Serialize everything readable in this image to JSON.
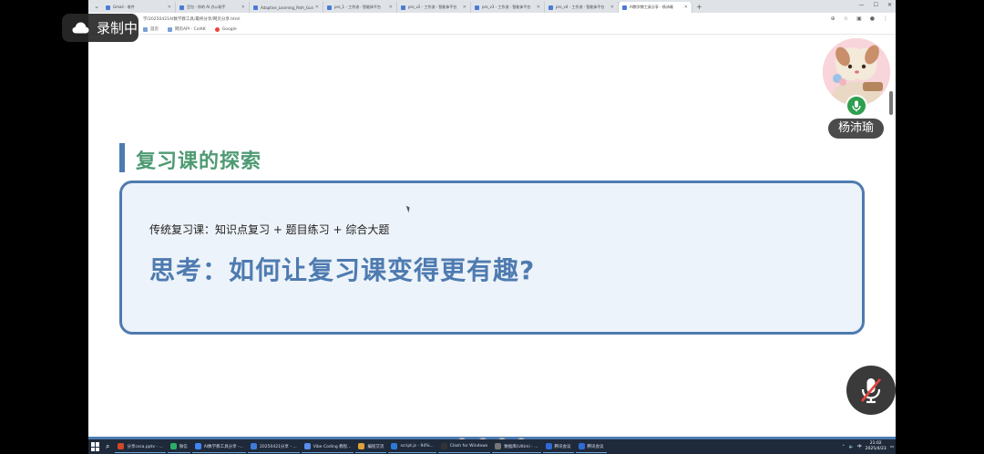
{
  "recording": {
    "label": "录制中"
  },
  "browser": {
    "tabs": [
      {
        "title": "Gmail - 收件"
      },
      {
        "title": "豆包 - 你的 AI 办公助手"
      },
      {
        "title": "Adaptive_Learning_Path_Guid..."
      },
      {
        "title": "pro_1 - 工作流 - 智能体平台"
      },
      {
        "title": "pro_v2 - 工作流 - 智能体平台"
      },
      {
        "title": "pro_v3 - 工作流 - 智能体平台"
      },
      {
        "title": "pro_v4 - 工作流 - 智能体平台"
      },
      {
        "title": "AI数学教工具分享 - 杨沛瑜",
        "active": true
      }
    ],
    "address": "学/20250421AI数学教工具/最终分享/网页分享.html",
    "bookmarks": [
      {
        "label": "首页"
      },
      {
        "label": "网页API - ColAK"
      },
      {
        "label": "Google"
      }
    ]
  },
  "slide": {
    "title": "复习课的探索",
    "line1": "传统复习课：知识点复习 + 题目练习 + 综合大题",
    "line2": "思考：如何让复习课变得更有趣?",
    "progress": 1.0
  },
  "participant": {
    "name": "杨沛瑜",
    "mic_on": true
  },
  "self_mic": {
    "muted": true
  },
  "taskbar": {
    "items": [
      {
        "label": "分享cssa.pptx - ...",
        "color": "#d24726"
      },
      {
        "label": "微信",
        "color": "#2aae67"
      },
      {
        "label": "AI数学教工具分享 -...",
        "color": "#4285f4"
      },
      {
        "label": "20250421分享 - ...",
        "color": "#3d7bd9"
      },
      {
        "label": "Vibe Coding 教程...",
        "color": "#5b8def"
      },
      {
        "label": "编程交流",
        "color": "#e0a03c"
      },
      {
        "label": "script.js - 94%...",
        "color": "#2b7bd6"
      },
      {
        "label": "Clash for Windows",
        "color": "#333"
      },
      {
        "label": "数据库(Ultimi - ...",
        "color": "#777"
      },
      {
        "label": "腾讯会议",
        "color": "#2f6bd6"
      },
      {
        "label": "腾讯会议",
        "color": "#2f6bd6"
      }
    ],
    "lang": "中",
    "time": "21:02",
    "date": "2025/4/23"
  },
  "colors": {
    "accent": "#4e7bb0",
    "title_green": "#4e9a73",
    "callout_bg": "#edf3fa"
  },
  "icons": {
    "cloud": "cloud-icon",
    "mic": "microphone-icon",
    "mic_off": "microphone-off-icon"
  }
}
